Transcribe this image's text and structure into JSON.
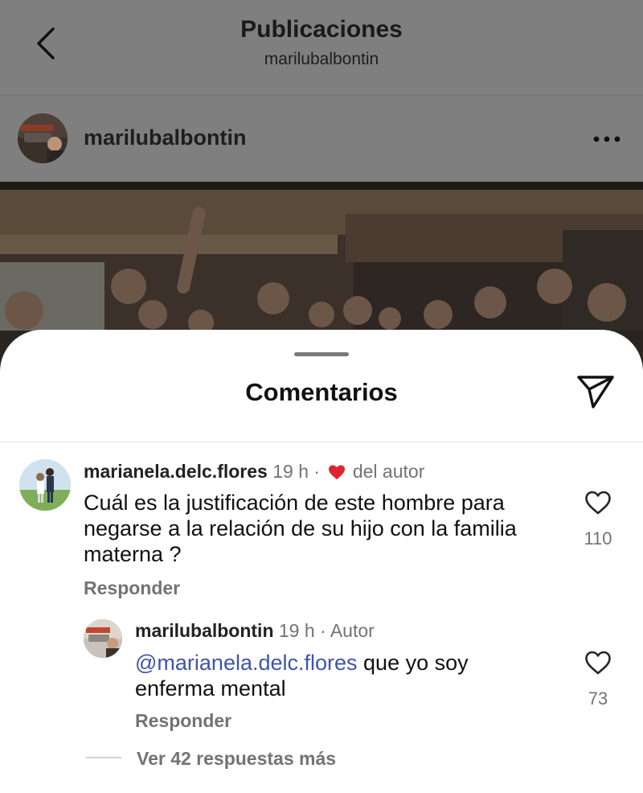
{
  "header": {
    "title": "Publicaciones",
    "subtitle": "marilubalbontin"
  },
  "post": {
    "author": "marilubalbontin"
  },
  "comments_sheet": {
    "title": "Comentarios",
    "comments": [
      {
        "user": "marianela.delc.flores",
        "time": "19 h",
        "separator": "·",
        "liked_by_author_label": "del autor",
        "text": "Cuál es la justificación de este hombre para negarse a la relación de su hijo con la familia materna ?",
        "reply_label": "Responder",
        "like_count": "110"
      },
      {
        "user": "marilubalbontin",
        "time": "19 h",
        "separator": "·",
        "author_badge": "Autor",
        "mention": "@marianela.delc.flores",
        "text": " que yo soy enferma mental",
        "reply_label": "Responder",
        "like_count": "73"
      }
    ],
    "view_more_replies": "Ver 42 respuestas más"
  },
  "colors": {
    "overlay": "#808080",
    "sheet": "#ffffff",
    "muted_text": "#737373",
    "mention": "#3e55a8",
    "heart_red": "#e0242f"
  },
  "icons": [
    "back-chevron-icon",
    "more-options-icon",
    "send-icon",
    "heart-icon"
  ]
}
